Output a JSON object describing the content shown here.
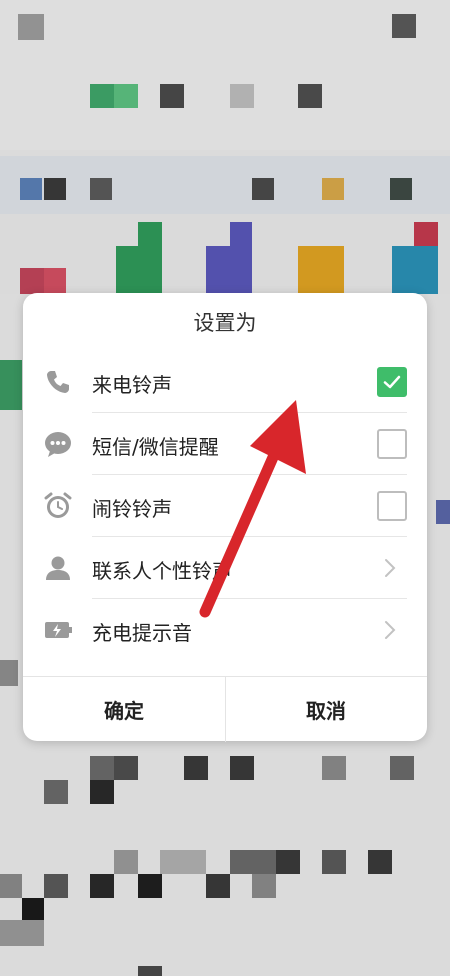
{
  "dialog": {
    "title": "设置为",
    "options": [
      {
        "label": "来电铃声",
        "icon": "phone-icon",
        "control": "checkbox",
        "checked": true
      },
      {
        "label": "短信/微信提醒",
        "icon": "message-bubble-icon",
        "control": "checkbox",
        "checked": false
      },
      {
        "label": "闹铃铃声",
        "icon": "alarm-clock-icon",
        "control": "checkbox",
        "checked": false
      },
      {
        "label": "联系人个性铃声",
        "icon": "contact-person-icon",
        "control": "chevron"
      },
      {
        "label": "充电提示音",
        "icon": "battery-charging-icon",
        "control": "chevron"
      }
    ],
    "confirm_label": "确定",
    "cancel_label": "取消"
  },
  "colors": {
    "checked": "#3fbd6a",
    "annotation_arrow": "#d8262b"
  }
}
